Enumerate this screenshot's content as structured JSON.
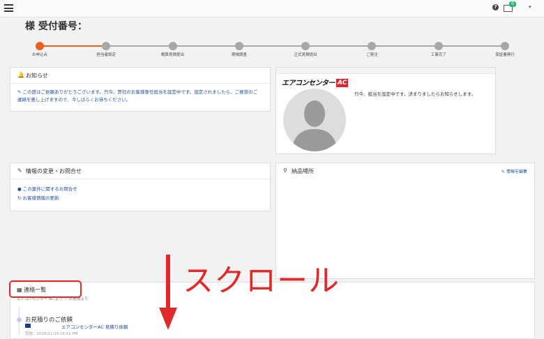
{
  "header": {
    "help_icon": "?",
    "mail_badge_count": "0",
    "user_caret": "▾"
  },
  "page": {
    "title": "様 受付番号："
  },
  "progress": {
    "active_color": "#e8601c",
    "inactive_color": "#a7a7a7",
    "current_step": 1,
    "steps": [
      {
        "label": "お申込み"
      },
      {
        "label": "担当者設定"
      },
      {
        "label": "概算見積提出"
      },
      {
        "label": "現場調査"
      },
      {
        "label": "正式見積提出"
      },
      {
        "label": "ご発注"
      },
      {
        "label": "工事完了"
      },
      {
        "label": "保証書発行"
      }
    ]
  },
  "notice": {
    "title": "お知らせ",
    "icon": "bell-icon",
    "text": "この度はご依頼ありがとうございます。只今、弊社のお客様専任担当を設定中です。設定されましたら、ご挨拶のご連絡を差し上げますので、今しばらくお待ちください。"
  },
  "staff": {
    "logo_text": "エアコンセンター",
    "logo_badge": "AC",
    "message": "只今、担当を設定中です。決まりましたらお知らせします。"
  },
  "info_change": {
    "title": "情報の変更・お問合せ",
    "icon": "edit-icon",
    "links": [
      {
        "label": "この案件に関するお問合せ",
        "icon": "comment-icon"
      },
      {
        "label": "お客様情報の更新",
        "icon": "refresh-icon"
      }
    ]
  },
  "delivery": {
    "title": "納品場所",
    "icon": "map-marker-icon",
    "edit_label": "情報を編集"
  },
  "contacts": {
    "title": "連絡一覧",
    "icon": "list-icon",
    "sub": "エアコンセンター AC より ・ お客様より",
    "entries": [
      {
        "title": "お見積りのご依頼",
        "line": "エアコンセンターAC 見積り依頼",
        "date": "受信：2016/11/10 16:51 PM"
      }
    ]
  },
  "annotation": {
    "scroll_label": "スクロール",
    "color": "#e02a2a"
  }
}
